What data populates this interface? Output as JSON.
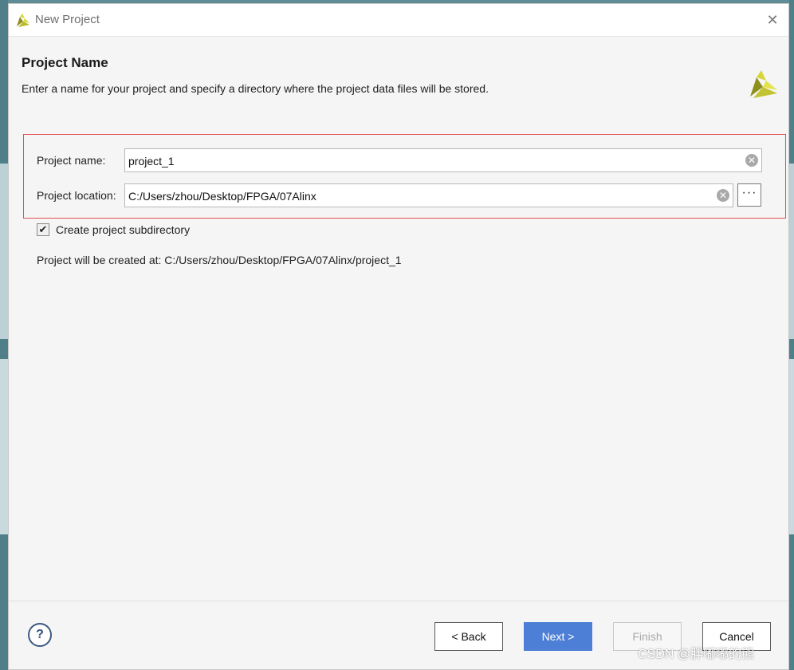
{
  "window": {
    "title": "New Project",
    "close_glyph": "✕"
  },
  "header": {
    "title": "Project Name",
    "description": "Enter a name for your project and specify a directory where the project data files will be stored."
  },
  "form": {
    "name_label": "Project name:",
    "name_value": "project_1",
    "location_label": "Project location:",
    "location_value": "C:/Users/zhou/Desktop/FPGA/07Alinx",
    "browse_label": "···",
    "clear_glyph": "✕",
    "subdir_checkbox_label": "Create project subdirectory",
    "subdir_checked": true,
    "check_glyph": "✔",
    "created_at_text": "Project will be created at: C:/Users/zhou/Desktop/FPGA/07Alinx/project_1"
  },
  "footer": {
    "help_label": "?",
    "back_label": "< Back",
    "next_label": "Next >",
    "finish_label": "Finish",
    "cancel_label": "Cancel"
  },
  "watermark": "CSDN @胖嘟嘟的熊",
  "colors": {
    "accent": "#4d7fd6",
    "highlight_border": "#e05050",
    "logo_dark": "#8f8f1e",
    "logo_light": "#d6d63a"
  },
  "icons": {
    "app_logo": "xilinx-logo-icon",
    "close": "close-icon",
    "clear": "clear-icon",
    "help": "help-icon",
    "check": "check-icon"
  }
}
